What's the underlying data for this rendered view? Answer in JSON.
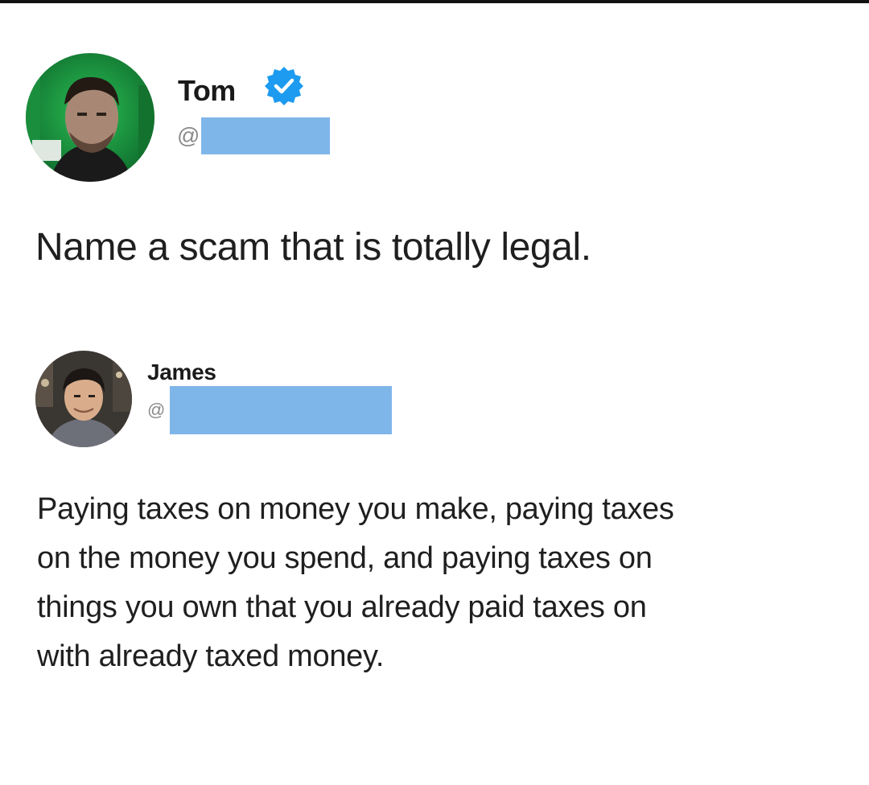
{
  "tweets": [
    {
      "author_name": "Tom",
      "verified": true,
      "handle_prefix": "@",
      "handle_redacted": true,
      "text": "Name a scam that is totally legal."
    },
    {
      "author_name": "James",
      "verified": false,
      "handle_prefix": "@",
      "handle_redacted": true,
      "text_lines": [
        "Paying taxes on money you make, paying taxes",
        "on the money you spend, and paying taxes on",
        "things you own that you already paid taxes on",
        "with already taxed money."
      ]
    }
  ],
  "icons": {
    "verified": "verified-badge-icon"
  },
  "colors": {
    "verified_badge": "#1d9bf0",
    "redaction": "#7fb6ea",
    "text": "#1f1f1f",
    "handle": "#8a8a8a"
  }
}
